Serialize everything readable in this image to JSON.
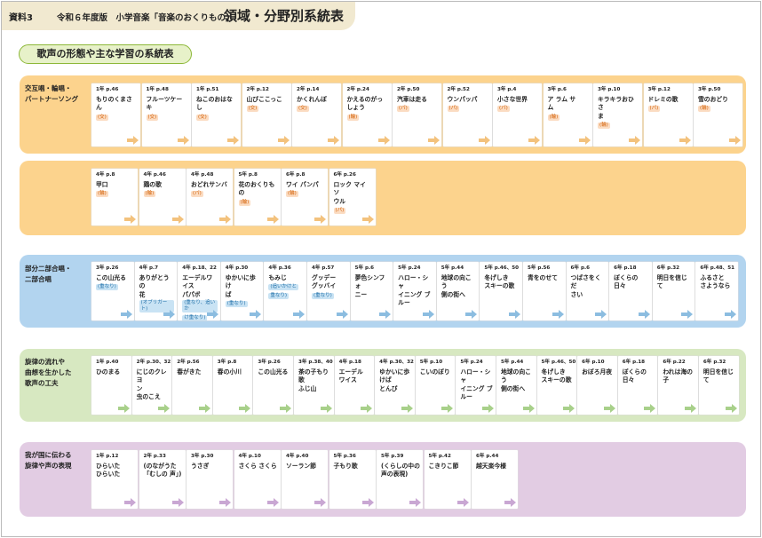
{
  "header": {
    "tag": "資料3",
    "subtitle": "令和６年度版　小学音楽「音楽のおくりもの」",
    "title": "領域・分野別系統表"
  },
  "badge": "歌声の形態や主な学習の系統表",
  "colors": {
    "header": "#f1e9d0",
    "orange": "#fcd38d",
    "blue": "#b2d4ef",
    "green": "#d7e8c1",
    "purple": "#e2cce3"
  },
  "sections": {
    "s1": {
      "label_lines": [
        "交互唱・輪唱・",
        "パートナーソング"
      ],
      "rows": [
        [
          {
            "ref": "1年 p.46",
            "lines": [
              "もりのくまさん"
            ],
            "tag": "(交)"
          },
          {
            "ref": "1年 p.48",
            "lines": [
              "フルーツケーキ"
            ],
            "tag": "(交)"
          },
          {
            "ref": "1年 p.51",
            "lines": [
              "ねこのおはなし"
            ],
            "tag": "(交)"
          },
          {
            "ref": "2年 p.12",
            "lines": [
              "山びここっこ"
            ],
            "tag": "(交)"
          },
          {
            "ref": "2年 p.14",
            "lines": [
              "かくれんぼ"
            ],
            "tag": "(交)"
          },
          {
            "ref": "2年 p.24",
            "lines": [
              "かえるのがっ",
              "しょう"
            ],
            "tag": "(輪)"
          },
          {
            "ref": "2年 p.50",
            "lines": [
              "汽車は走る"
            ],
            "tag": "(パ)"
          },
          {
            "ref": "2年 p.52",
            "lines": [
              "ウンパッパ"
            ],
            "tag": "(パ)"
          },
          {
            "ref": "3年 p.4",
            "lines": [
              "小さな世界"
            ],
            "tag": "(パ)"
          },
          {
            "ref": "3年 p.6",
            "lines": [
              "ア ラム サ",
              "ム"
            ],
            "tag": "(輪)"
          },
          {
            "ref": "3年 p.10",
            "lines": [
              "キラキラおひさ",
              "ま"
            ],
            "tag": "(輪)"
          },
          {
            "ref": "3年 p.12",
            "lines": [
              "ドレミの歌"
            ],
            "tag": "(パ)"
          },
          {
            "ref": "3年 p.50",
            "lines": [
              "雪のおどり"
            ],
            "tag": "(輪)"
          }
        ],
        [
          {
            "ref": "4年 p.8",
            "lines": [
              "甲口"
            ],
            "tag": "(輪)"
          },
          {
            "ref": "4年 p.46",
            "lines": [
              "鶏の歌"
            ],
            "tag": "(輪)"
          },
          {
            "ref": "4年 p.48",
            "lines": [
              "おどれサンバ"
            ],
            "tag": "(パ)"
          },
          {
            "ref": "5年 p.8",
            "lines": [
              "花のおくりもの"
            ],
            "tag": "(輪)"
          },
          {
            "ref": "6年 p.8",
            "lines": [
              "ワイ パンパ"
            ],
            "tag": "(輪)"
          },
          {
            "ref": "6年 p.26",
            "lines": [
              "ロック マイ ソ",
              "ウル"
            ],
            "tag": "(パ)"
          }
        ]
      ]
    },
    "s2": {
      "label_lines": [
        "部分二部合唱・",
        "二部合唱"
      ],
      "cards": [
        {
          "ref": "3年 p.26",
          "lines": [
            "この山光る"
          ],
          "tag": "(重なり)"
        },
        {
          "ref": "4年 p.7",
          "lines": [
            "ありがとうの",
            "花"
          ],
          "tag": "(オブリガート)"
        },
        {
          "ref": "4年 p.18、22",
          "lines": [
            "エーデルワイス",
            "パパボ"
          ],
          "tag": "(重なり、追いか",
          "tag2": "け重なり)"
        },
        {
          "ref": "4年 p.30",
          "lines": [
            "ゆかいに歩け",
            "ば"
          ],
          "tag": "(重なり)"
        },
        {
          "ref": "4年 p.36",
          "lines": [
            "もみじ"
          ],
          "tag": "(追いかけと",
          "tag2": "重なり)"
        },
        {
          "ref": "4年 p.57",
          "lines": [
            "グッデー",
            "グッバイ"
          ],
          "tag": "(重なり)"
        },
        {
          "ref": "5年 p.6",
          "lines": [
            "夢色シンフォ",
            "ニー"
          ]
        },
        {
          "ref": "5年 p.24",
          "lines": [
            "ハロー・シャ",
            "イニング ブ",
            "ルー"
          ]
        },
        {
          "ref": "5年 p.44",
          "lines": [
            "地球の向こう",
            "側の街へ"
          ]
        },
        {
          "ref": "5年 p.46、50",
          "lines": [
            "冬げしき",
            "スキーの歌"
          ]
        },
        {
          "ref": "5年 p.56",
          "lines": [
            "青をのせて"
          ]
        },
        {
          "ref": "6年 p.6",
          "lines": [
            "つばさをくだ",
            "さい"
          ]
        },
        {
          "ref": "6年 p.18",
          "lines": [
            "ぼくらの日々"
          ]
        },
        {
          "ref": "6年 p.32",
          "lines": [
            "明日を信じて"
          ]
        },
        {
          "ref": "6年 p.48、51",
          "lines": [
            "ふるさと",
            "さようなら"
          ]
        }
      ]
    },
    "s3": {
      "label_lines": [
        "旋律の流れや",
        "曲想を生かした",
        "歌声の工夫"
      ],
      "cards": [
        {
          "ref": "1年 p.40",
          "lines": [
            "ひのまる"
          ]
        },
        {
          "ref": "2年 p.30、32",
          "lines": [
            "にじのクレヨ",
            "ン",
            "虫のこえ"
          ]
        },
        {
          "ref": "2年 p.56",
          "lines": [
            "春がきた"
          ]
        },
        {
          "ref": "3年 p.8",
          "lines": [
            "春の小川"
          ]
        },
        {
          "ref": "3年 p.26",
          "lines": [
            "この山光る"
          ]
        },
        {
          "ref": "3年 p.38、40",
          "lines": [
            "茶の子もり歌",
            "ふじ山"
          ]
        },
        {
          "ref": "4年 p.18",
          "lines": [
            "エーデル",
            "ワイス"
          ]
        },
        {
          "ref": "4年 p.30、32",
          "lines": [
            "ゆかいに歩けば",
            "とんび"
          ]
        },
        {
          "ref": "5年 p.10",
          "lines": [
            "こいのぼり"
          ]
        },
        {
          "ref": "5年 p.24",
          "lines": [
            "ハロー・シャ",
            "イニング ブ",
            "ルー"
          ]
        },
        {
          "ref": "5年 p.44",
          "lines": [
            "地球の向こう",
            "側の街へ"
          ]
        },
        {
          "ref": "5年 p.46、50",
          "lines": [
            "冬げしき",
            "スキーの歌"
          ]
        },
        {
          "ref": "6年 p.10",
          "lines": [
            "おぼろ月夜"
          ]
        },
        {
          "ref": "6年 p.18",
          "lines": [
            "ぼくらの日々"
          ]
        },
        {
          "ref": "6年 p.22",
          "lines": [
            "われは海の子"
          ]
        },
        {
          "ref": "6年 p.32",
          "lines": [
            "明日を信じて"
          ]
        }
      ]
    },
    "s4": {
      "label_lines": [
        "我が国に伝わる",
        "旋律や声の表現"
      ],
      "cards": [
        {
          "ref": "1年 p.12",
          "lines": [
            "ひらいた",
            "ひらいた"
          ]
        },
        {
          "ref": "2年 p.33",
          "lines": [
            "(のながうた",
            "「むしの 声」)"
          ]
        },
        {
          "ref": "3年 p.30",
          "lines": [
            "うさぎ"
          ]
        },
        {
          "ref": "4年 p.10",
          "lines": [
            "さくら さくら"
          ]
        },
        {
          "ref": "4年 p.40",
          "lines": [
            "ソーラン節"
          ]
        },
        {
          "ref": "5年 p.36",
          "lines": [
            "子もり歌"
          ]
        },
        {
          "ref": "5年 p.39",
          "lines": [
            "(くらしの中の",
            "声の表現)"
          ]
        },
        {
          "ref": "5年 p.42",
          "lines": [
            "こきりこ節"
          ]
        },
        {
          "ref": "6年 p.44",
          "lines": [
            "越天楽今様"
          ]
        }
      ]
    }
  }
}
